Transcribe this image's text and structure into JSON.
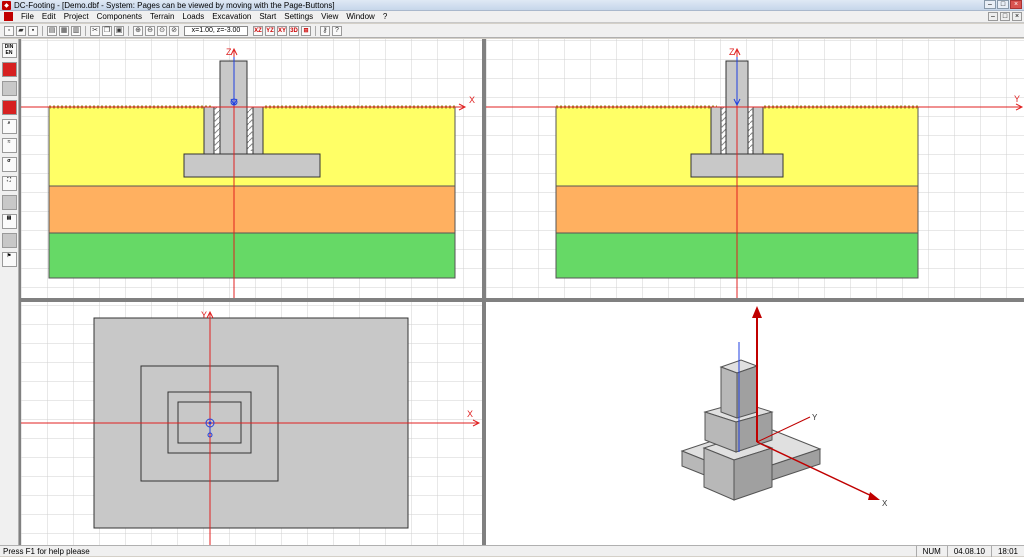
{
  "window": {
    "title": "DC-Footing - [Demo.dbf - System: Pages can be viewed by moving with the Page-Buttons]",
    "minimize": "–",
    "maximize": "□",
    "close": "×"
  },
  "menu": {
    "items": [
      "File",
      "Edit",
      "Project",
      "Components",
      "Terrain",
      "Loads",
      "Excavation",
      "Start",
      "Settings",
      "View",
      "Window",
      "?"
    ],
    "mdi": [
      "–",
      "□",
      "×"
    ]
  },
  "toolbar": {
    "coord_text": "x=1.00, z=-3.00",
    "view_xz": "XZ",
    "view_yz": "YZ",
    "view_xy": "XY",
    "view_3d": "3D",
    "view_all": "⊞"
  },
  "leftbar": {
    "din_label": "DIN EN"
  },
  "views": {
    "front": {
      "horizontal_axis": "X",
      "vertical_axis": "Z"
    },
    "side": {
      "horizontal_axis": "Y",
      "vertical_axis": "Z"
    },
    "plan": {
      "horizontal_axis": "X",
      "vertical_axis": "Y"
    },
    "iso": {
      "axis_x": "X",
      "axis_y": "Y"
    }
  },
  "colors": {
    "soil_top": "#ffff66",
    "soil_mid": "#ffb060",
    "soil_bottom": "#66d966",
    "concrete": "#c8c8c8",
    "axis_red": "#e02020",
    "axis_blue": "#2040e0",
    "grid": "#d0d0d0"
  },
  "status": {
    "message": "Press F1 for help please",
    "num": "NUM",
    "date": "04.08.10",
    "time": "18:01"
  }
}
